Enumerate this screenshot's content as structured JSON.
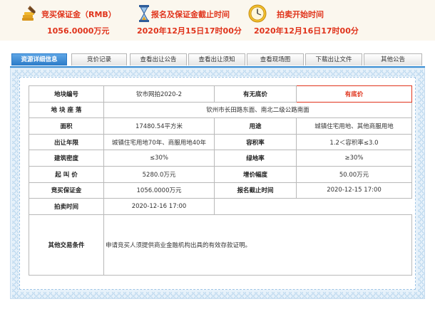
{
  "summary": {
    "deposit": {
      "label": "竞买保证金（RMB）",
      "value": "1056.0000万元",
      "icon": "money-bag-icon"
    },
    "deadline": {
      "label": "报名及保证金截止时间",
      "value": "2020年12月15日17时00分",
      "icon": "hourglass-icon"
    },
    "auction_start": {
      "label": "拍卖开始时间",
      "value": "2020年12月16日17时00分",
      "icon": "clock-icon"
    }
  },
  "tabs": [
    "资源详细信息",
    "竞价记录",
    "查看出让公告",
    "查看出让须知",
    "查看现场图",
    "下载出让文件",
    "其他公告"
  ],
  "active_tab": 0,
  "info": {
    "plot_no_label": "地块编号",
    "plot_no": "钦市网拍2020-2",
    "floor_label": "有无底价",
    "floor": "有底价",
    "location_label": "地 块 座 落",
    "location": "钦州市长田路东面、南北二级公路南面",
    "area_label": "面积",
    "area": "17480.54平方米",
    "use_label": "用途",
    "use": "城镇住宅用地、其他商服用地",
    "term_label": "出让年限",
    "term": "城镇住宅用地70年、商服用地40年",
    "far_label": "容积率",
    "far": "1.2＜容积率≤3.0",
    "density_label": "建筑密度",
    "density": "≤30%",
    "green_label": "绿地率",
    "green": "≥30%",
    "start_price_label": "起 叫 价",
    "start_price": "5280.0万元",
    "increment_label": "增价幅度",
    "increment": "50.00万元",
    "deposit_label": "竞买保证金",
    "deposit": "1056.0000万元",
    "deadline_label": "报名截止时间",
    "deadline": "2020-12-15 17:00",
    "auction_time_label": "拍卖时间",
    "auction_time": "2020-12-16 17:00",
    "other_label": "其他交易条件",
    "other": "申请竞买人须提供商业金融机构出具的有效存款证明。"
  },
  "colors": {
    "accent": "#e0341c",
    "tab_active": "#2b7bc8",
    "frame": "#e6f1fa"
  }
}
